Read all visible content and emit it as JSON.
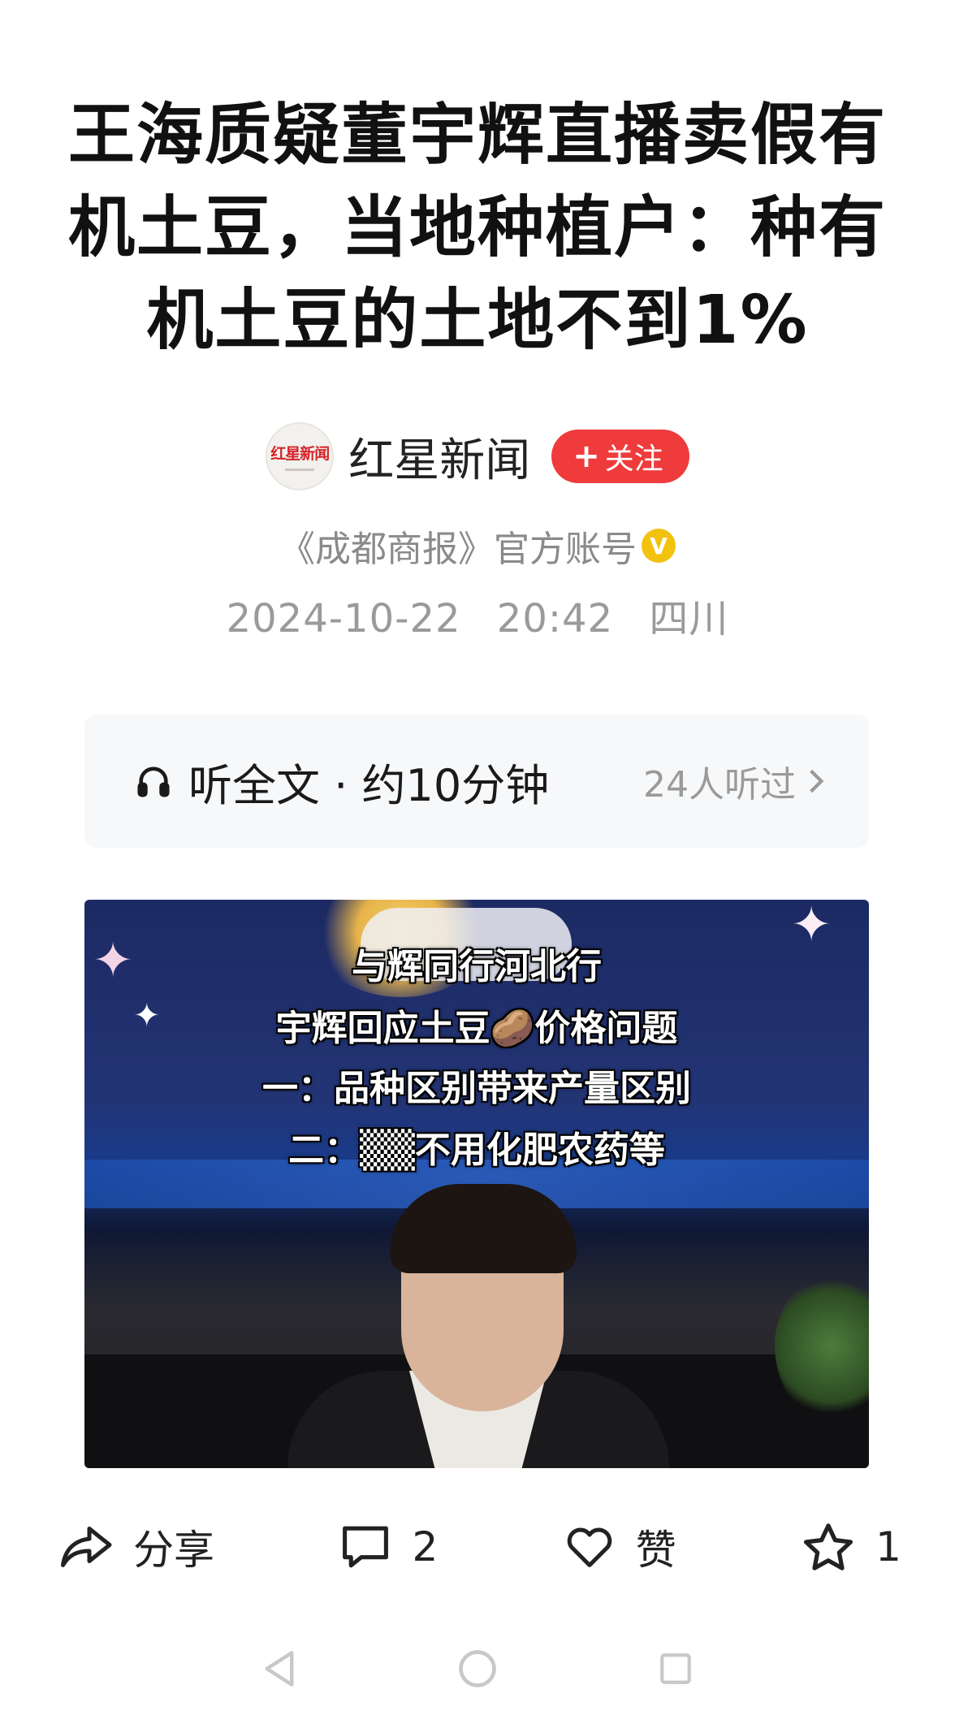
{
  "article": {
    "title": "王海质疑董宇辉直播卖假有机土豆，当地种植户：种有机土豆的土地不到1%"
  },
  "author": {
    "logo_text": "红星新闻",
    "name": "红星新闻",
    "follow_label": "关注",
    "official_text": "《成都商报》官方账号",
    "verified_mark": "V"
  },
  "meta": {
    "date": "2024-10-22",
    "time": "20:42",
    "location": "四川"
  },
  "listen": {
    "label": "听全文 · 约10分钟",
    "listeners": "24人听过"
  },
  "video": {
    "caption_lines": [
      "与辉同行河北行",
      "宇辉回应土豆🥔价格问题",
      "一：品种区别带来产量区别",
      "二：▒▒不用化肥农药等"
    ]
  },
  "actions": {
    "share_label": "分享",
    "comment_count": "2",
    "like_label": "赞",
    "favorite_count": "1"
  },
  "icons": {
    "follow": "plus-icon",
    "verified": "verified-badge-icon",
    "listen": "headphones-icon",
    "chevron": "chevron-right-icon",
    "share": "share-icon",
    "comment": "comment-icon",
    "like": "heart-icon",
    "favorite": "star-icon",
    "nav_back": "back-triangle-icon",
    "nav_home": "home-circle-icon",
    "nav_recent": "recent-square-icon"
  },
  "colors": {
    "follow_button": "#ef3b3b",
    "verified": "#f2c20f",
    "muted_text": "#9a9a9a"
  }
}
